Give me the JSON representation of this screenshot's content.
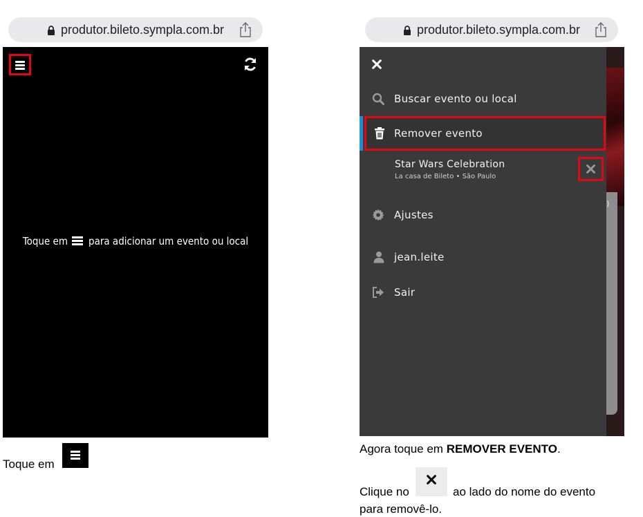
{
  "left_phone": {
    "url": "produtor.bileto.sympla.com.br",
    "empty_message_prefix": "Toque em",
    "empty_message_suffix": "para adicionar um evento ou local"
  },
  "right_phone": {
    "url": "produtor.bileto.sympla.com.br",
    "menu": {
      "search_label": "Buscar evento ou local",
      "remove_label": "Remover evento",
      "event_name": "Star Wars Celebration",
      "event_venue": "La casa de Bileto • São Paulo",
      "settings_label": "Ajustes",
      "user_label": "jean.leite",
      "logout_label": "Sair"
    }
  },
  "captions": {
    "left": "Toque em",
    "right_1_prefix": "Agora toque em ",
    "right_1_bold": "REMOVER EVENTO",
    "right_1_suffix": ".",
    "right_2_prefix": "Clique no",
    "right_2_suffix": "ao lado do nome do evento",
    "right_3": "para removê-lo."
  },
  "colors": {
    "highlight": "#e30613",
    "accent": "#1e90d6",
    "drawer": "#3a3a3a"
  }
}
